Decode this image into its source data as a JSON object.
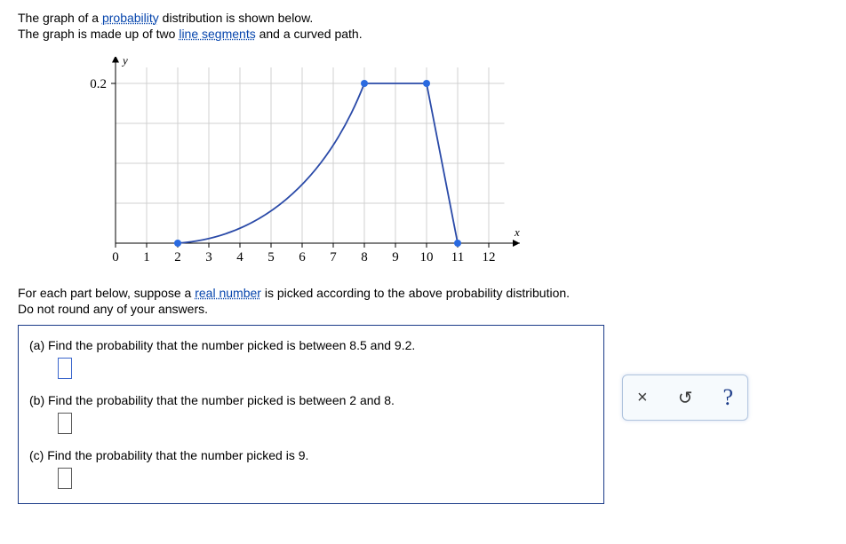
{
  "intro": {
    "line1_a": "The graph of a ",
    "link1": "probability",
    "line1_b": " distribution is shown below.",
    "line2_a": "The graph is made up of two ",
    "link2": "line segments",
    "line2_b": " and a curved path."
  },
  "chart_data": {
    "type": "line",
    "x_ticks": [
      0,
      1,
      2,
      3,
      4,
      5,
      6,
      7,
      8,
      9,
      10,
      11,
      12
    ],
    "y_ticks": [
      0.2
    ],
    "xlabel": "x",
    "ylabel": "y",
    "xlim": [
      0,
      13
    ],
    "ylim": [
      0,
      0.23
    ],
    "segments": [
      {
        "kind": "curve",
        "from": {
          "x": 2,
          "y": 0
        },
        "to": {
          "x": 8,
          "y": 0.2
        }
      },
      {
        "kind": "line",
        "from": {
          "x": 8,
          "y": 0.2
        },
        "to": {
          "x": 10,
          "y": 0.2
        }
      },
      {
        "kind": "line",
        "from": {
          "x": 10,
          "y": 0.2
        },
        "to": {
          "x": 11,
          "y": 0
        }
      }
    ],
    "points": [
      {
        "x": 2,
        "y": 0
      },
      {
        "x": 8,
        "y": 0.2
      },
      {
        "x": 10,
        "y": 0.2
      },
      {
        "x": 11,
        "y": 0
      }
    ]
  },
  "mid": {
    "line1_a": "For each part below, suppose a ",
    "link3": "real number",
    "line1_b": " is picked according to the above probability distribution.",
    "line2": "Do not round any of your answers."
  },
  "questions": {
    "a": "(a) Find the probability that the number picked is between 8.5 and 9.2.",
    "b": "(b) Find the probability that the number picked is between 2 and 8.",
    "c": "(c) Find the probability that the number picked is 9."
  },
  "toolbar": {
    "clear": "×",
    "reset": "↺",
    "help": "?"
  }
}
